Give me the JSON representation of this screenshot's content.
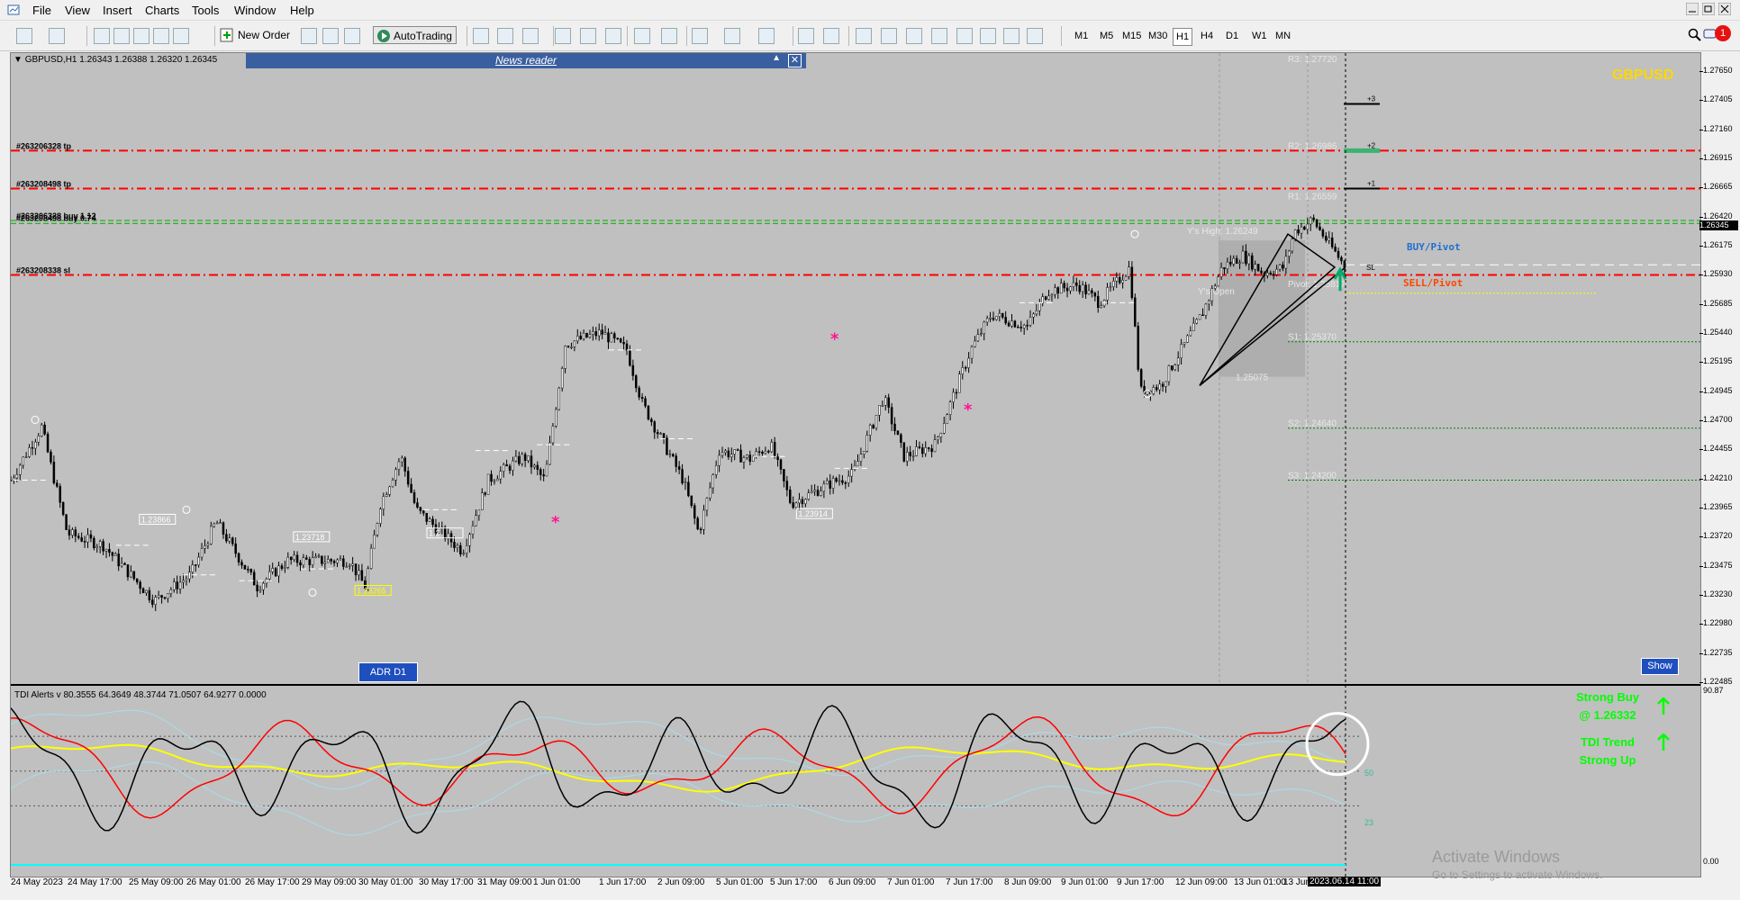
{
  "menu": [
    "File",
    "View",
    "Insert",
    "Charts",
    "Tools",
    "Window",
    "Help"
  ],
  "toolbar": {
    "new_order": "New Order",
    "autotrading": "AutoTrading",
    "timeframes": [
      "M1",
      "M5",
      "M15",
      "M30",
      "H1",
      "H4",
      "D1",
      "W1",
      "MN"
    ],
    "active_timeframe": "H1",
    "alert_count": "1"
  },
  "chart": {
    "header": "GBPUSD,H1  1.26343 1.26388 1.26320 1.26345",
    "symbol_watermark": "GBPUSD",
    "news_reader": "News reader",
    "adr_button": "ADR D1",
    "show_button": "Show",
    "order_lines": [
      {
        "label": "#263206328 tp",
        "price": 1.26985,
        "color": "#ff0000"
      },
      {
        "label": "#263208498 tp",
        "price": 1.26665,
        "color": "#ff0000"
      },
      {
        "label": "#263206328 buy 1.12",
        "price": 1.26395,
        "color": "#00aa00"
      },
      {
        "label": "#263208498 buy 0.74",
        "price": 1.2637,
        "color": "#00aa00"
      },
      {
        "label": "#263208338 sl",
        "price": 1.25935,
        "color": "#ff0000"
      }
    ],
    "pivots": [
      {
        "label": "R3: 1.27720",
        "price": 1.2772
      },
      {
        "label": "R2: 1.26986",
        "price": 1.26986
      },
      {
        "label": "R1: 1.26559",
        "price": 1.26559
      },
      {
        "label": "Pivot: 1.25817",
        "price": 1.25817
      },
      {
        "label": "S1: 1.25370",
        "price": 1.2537
      },
      {
        "label": "S2: 1.24640",
        "price": 1.2464
      },
      {
        "label": "S3: 1.24200",
        "price": 1.242
      }
    ],
    "ys_high": "Y's High: 1.26249",
    "ys_open": "Y's Open",
    "ys_low": "1.25075",
    "price_tags": [
      "1.23866",
      "1.23718",
      "1.23265",
      "1.23914",
      "1.2"
    ],
    "buy_pivot": "BUY/Pivot",
    "sell_pivot": "SELL/Pivot",
    "targets": [
      "+3",
      "+2",
      "+1"
    ],
    "sl_tag": "SL",
    "current_price": "1.26345",
    "y_ticks": [
      "1.27650",
      "1.27405",
      "1.27160",
      "1.26915",
      "1.26665",
      "1.26420",
      "1.26175",
      "1.25930",
      "1.25685",
      "1.25440",
      "1.25195",
      "1.24945",
      "1.24700",
      "1.24455",
      "1.24210",
      "1.23965",
      "1.23720",
      "1.23475",
      "1.23230",
      "1.22980",
      "1.22735",
      "1.22485"
    ],
    "x_ticks": [
      "24 May 2023",
      "24 May 17:00",
      "25 May 09:00",
      "26 May 01:00",
      "26 May 17:00",
      "29 May 09:00",
      "30 May 01:00",
      "30 May 17:00",
      "31 May 09:00",
      "1 Jun 01:00",
      "1 Jun 17:00",
      "2 Jun 09:00",
      "5 Jun 01:00",
      "5 Jun 17:00",
      "6 Jun 09:00",
      "7 Jun 01:00",
      "7 Jun 17:00",
      "8 Jun 09:00",
      "9 Jun 01:00",
      "9 Jun 17:00",
      "12 Jun 09:00",
      "13 Jun 01:00",
      "13 Jun"
    ],
    "x_cursor_label": "2023.06.14 11:00"
  },
  "indicator": {
    "header": "TDI Alerts v 80.3555 64.3649 48.3744 71.0507 64.9277 0.0000",
    "y_ticks": [
      "90.87",
      "50",
      "23",
      "0.00"
    ],
    "signal1_line1": "Strong Buy",
    "signal1_line2": "@ 1.26332",
    "signal2_line1": "TDI Trend",
    "signal2_line2": "Strong Up"
  },
  "watermark": {
    "line1": "Activate Windows",
    "line2": "Go to Settings to activate Windows."
  },
  "colors": {
    "chart_bg": "#c0c0c0",
    "tp_sl": "#ff0000",
    "buy": "#00aa00",
    "tdi_price": "#000000",
    "tdi_signal": "#ff0000",
    "tdi_market_base": "#ffff00",
    "tdi_bands": "#add8e6"
  }
}
